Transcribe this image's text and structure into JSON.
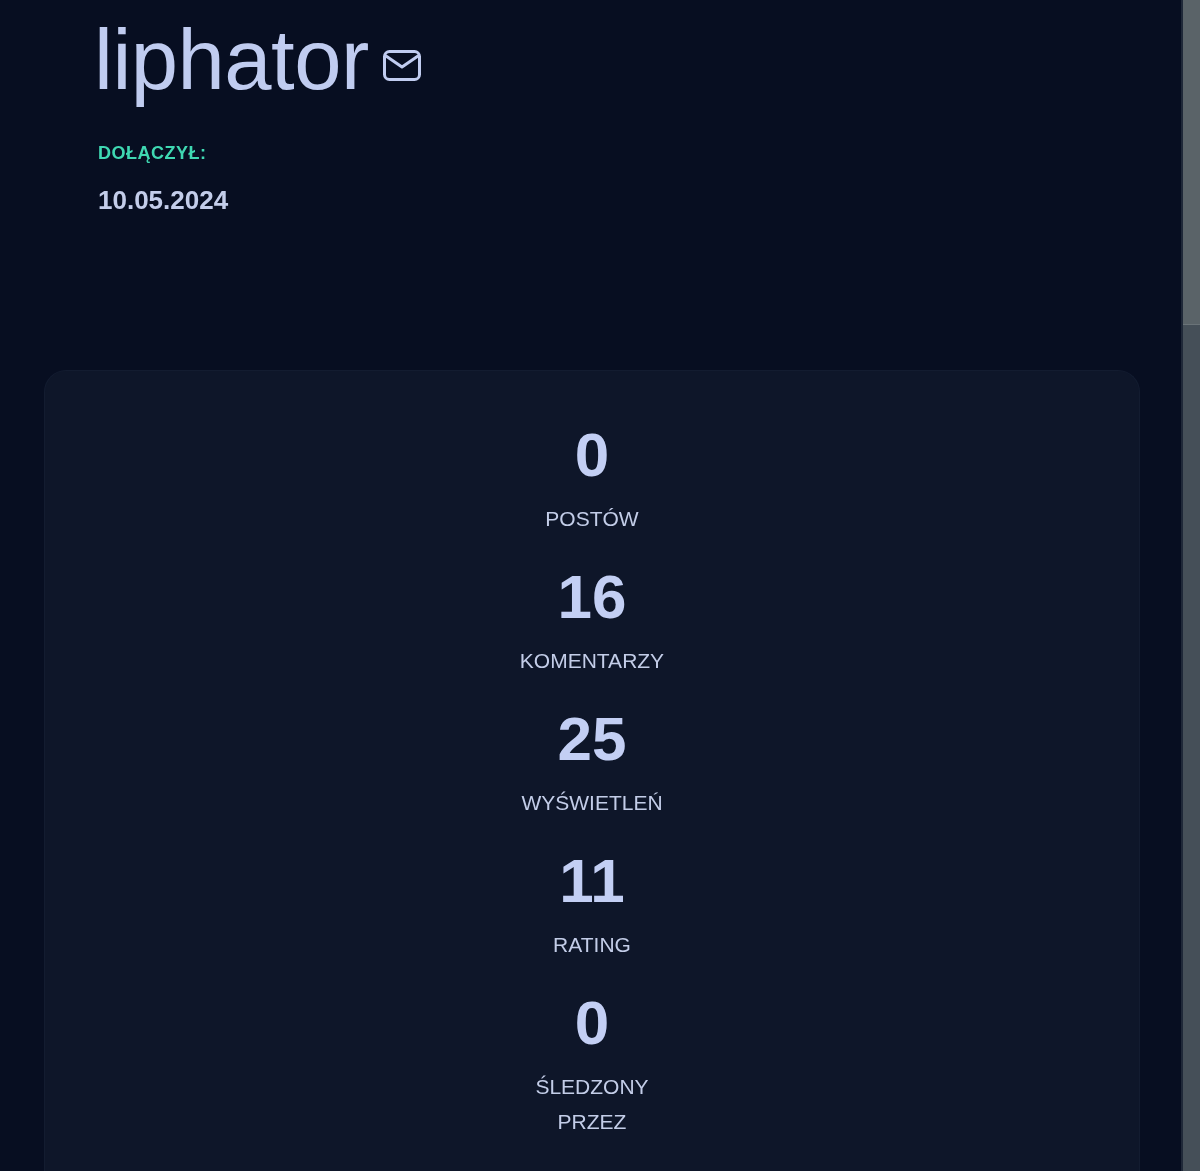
{
  "profile": {
    "username": "liphator",
    "joined_label": "DOŁĄCZYŁ:",
    "joined_date": "10.05.2024"
  },
  "stats": [
    {
      "value": "0",
      "label": "POSTÓW"
    },
    {
      "value": "16",
      "label": "KOMENTARZY"
    },
    {
      "value": "25",
      "label": "WYŚWIETLEŃ"
    },
    {
      "value": "11",
      "label": "RATING"
    },
    {
      "value": "0",
      "label": "ŚLEDZONY PRZEZ"
    }
  ]
}
